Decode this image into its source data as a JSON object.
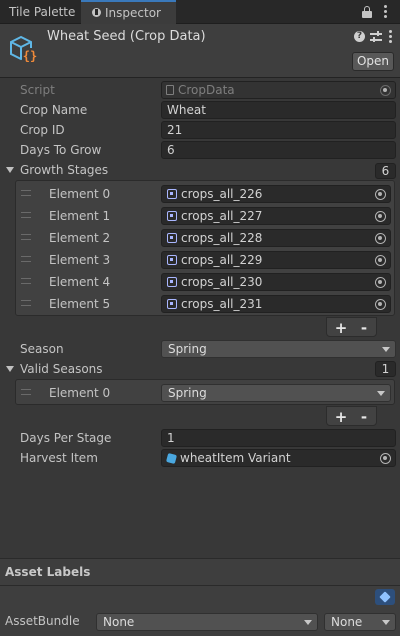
{
  "tabs": [
    {
      "label": "Tile Palette"
    },
    {
      "label": "Inspector"
    }
  ],
  "header": {
    "title": "Wheat Seed (Crop Data)",
    "open_label": "Open"
  },
  "fields": {
    "script_label": "Script",
    "script_value": "CropData",
    "crop_name_label": "Crop Name",
    "crop_name_value": "Wheat",
    "crop_id_label": "Crop ID",
    "crop_id_value": "21",
    "days_to_grow_label": "Days To Grow",
    "days_to_grow_value": "6",
    "growth_stages_label": "Growth Stages",
    "growth_stages_count": "6",
    "season_label": "Season",
    "season_value": "Spring",
    "valid_seasons_label": "Valid Seasons",
    "valid_seasons_count": "1",
    "days_per_stage_label": "Days Per Stage",
    "days_per_stage_value": "1",
    "harvest_item_label": "Harvest Item",
    "harvest_item_value": "wheatItem Variant"
  },
  "growth_stages": [
    {
      "label": "Element 0",
      "value": "crops_all_226"
    },
    {
      "label": "Element 1",
      "value": "crops_all_227"
    },
    {
      "label": "Element 2",
      "value": "crops_all_228"
    },
    {
      "label": "Element 3",
      "value": "crops_all_229"
    },
    {
      "label": "Element 4",
      "value": "crops_all_230"
    },
    {
      "label": "Element 5",
      "value": "crops_all_231"
    }
  ],
  "valid_seasons": [
    {
      "label": "Element 0",
      "value": "Spring"
    }
  ],
  "list_controls": {
    "plus": "+",
    "minus": "-"
  },
  "footer": {
    "asset_labels_title": "Asset Labels",
    "assetbundle_label": "AssetBundle",
    "assetbundle_value": "None",
    "variant_value": "None"
  },
  "colors": {
    "accent": "#3a79bb",
    "sprite_icon": "#a9b6ff",
    "asset_icon": "#4aa8e0",
    "label_tag": "#4f8bd0"
  }
}
